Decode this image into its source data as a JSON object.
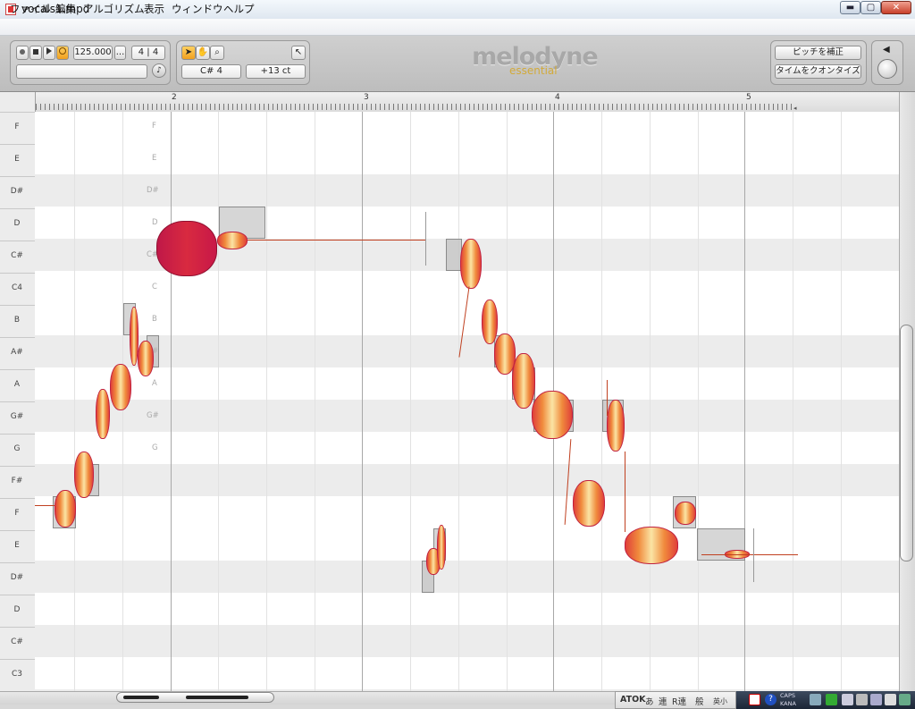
{
  "window": {
    "title": "vocals1.mpd",
    "min_label": "▬",
    "max_label": "▢",
    "close_label": "✕"
  },
  "menu": [
    "ファイル",
    "編集",
    "アルゴリズム",
    "表示",
    "ウィンドウ",
    "ヘルプ"
  ],
  "transport": {
    "tempo": "125.000",
    "tempo_more": "...",
    "meter": "4 | 4"
  },
  "tools": {
    "note": "C# 4",
    "cents": "+13 ct"
  },
  "logo": {
    "name": "melodyne",
    "edition": "essential"
  },
  "actions": {
    "correct_pitch": "ピッチを補正",
    "quantize_time": "タイムをクオンタイズ"
  },
  "ruler": {
    "bars": [
      "2",
      "3",
      "4",
      "5"
    ]
  },
  "keys": [
    "F",
    "E",
    "D#",
    "D",
    "C#",
    "C4",
    "B",
    "A#",
    "A",
    "G#",
    "G",
    "F#",
    "F",
    "E",
    "D#",
    "D",
    "C#",
    "C3"
  ],
  "scale_labels": [
    "F",
    "E",
    "D#",
    "D",
    "C#",
    "C",
    "B",
    "A#",
    "A",
    "G#",
    "G"
  ],
  "ime": [
    "ATOK",
    "あ",
    "連",
    "R連",
    "般",
    "英小"
  ],
  "tray": {
    "caps": "CAPS",
    "kana": "KANA"
  }
}
